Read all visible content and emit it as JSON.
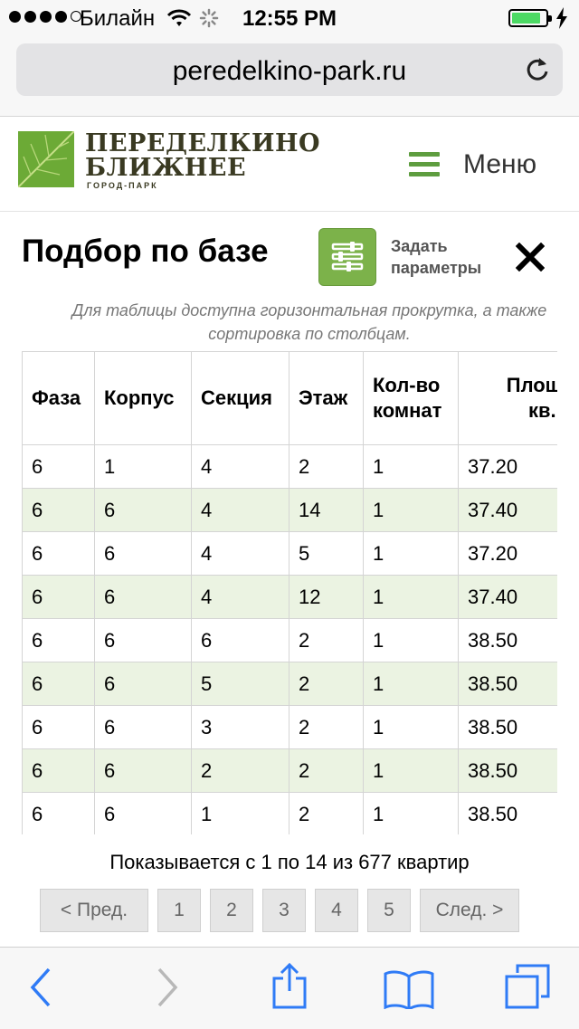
{
  "status_bar": {
    "carrier": "Билайн",
    "time": "12:55 PM",
    "battery_level": 0.85
  },
  "browser": {
    "url": "peredelkino-park.ru"
  },
  "site": {
    "logo_line1": "ПЕРЕДЕЛКИНО",
    "logo_line2": "БЛИЖНЕЕ",
    "logo_sub": "ГОРОД-ПАРК",
    "menu_label": "Меню"
  },
  "panel": {
    "title": "Подбор по базе",
    "params_line1": "Задать",
    "params_line2": "параметры",
    "hint_line1": "Для таблицы доступна горизонтальная прокрутка, а также",
    "hint_line2": "сортировка по столбцам."
  },
  "table": {
    "headers": [
      [
        "Фаза"
      ],
      [
        "Корпус"
      ],
      [
        "Секция"
      ],
      [
        "Этаж"
      ],
      [
        "Кол-во",
        "комнат"
      ],
      [
        "Площадь",
        "кв. м"
      ]
    ],
    "rows": [
      [
        "6",
        "1",
        "4",
        "2",
        "1",
        "37.20"
      ],
      [
        "6",
        "6",
        "4",
        "14",
        "1",
        "37.40"
      ],
      [
        "6",
        "6",
        "4",
        "5",
        "1",
        "37.20"
      ],
      [
        "6",
        "6",
        "4",
        "12",
        "1",
        "37.40"
      ],
      [
        "6",
        "6",
        "6",
        "2",
        "1",
        "38.50"
      ],
      [
        "6",
        "6",
        "5",
        "2",
        "1",
        "38.50"
      ],
      [
        "6",
        "6",
        "3",
        "2",
        "1",
        "38.50"
      ],
      [
        "6",
        "6",
        "2",
        "2",
        "1",
        "38.50"
      ],
      [
        "6",
        "6",
        "1",
        "2",
        "1",
        "38.50"
      ]
    ]
  },
  "pagination": {
    "showing": "Показывается с 1 по 14 из 677 квартир",
    "prev": "< Пред.",
    "pages": [
      "1",
      "2",
      "3",
      "4",
      "5"
    ],
    "next": "След. >"
  },
  "colors": {
    "accent_green": "#7cb24a",
    "row_stripe": "#ebf3e2",
    "ios_blue": "#2f7bf6"
  },
  "icons": {
    "toolbar": [
      "back-icon",
      "forward-icon",
      "share-icon",
      "bookmarks-icon",
      "tabs-icon"
    ]
  }
}
